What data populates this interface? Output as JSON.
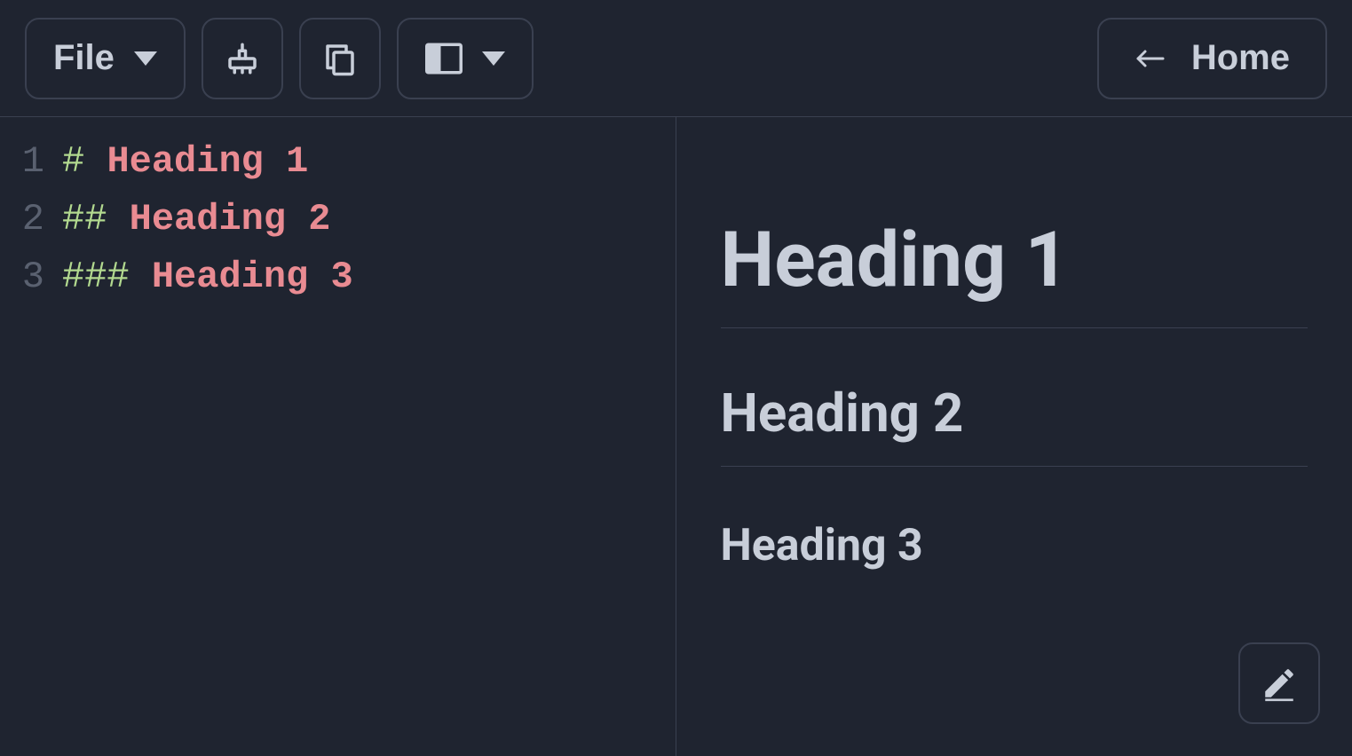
{
  "toolbar": {
    "file_label": "File",
    "home_label": "Home"
  },
  "editor": {
    "lines": [
      {
        "num": "1",
        "hashes": "#",
        "space": " ",
        "text": "Heading 1"
      },
      {
        "num": "2",
        "hashes": "##",
        "space": " ",
        "text": "Heading 2"
      },
      {
        "num": "3",
        "hashes": "###",
        "space": " ",
        "text": "Heading 3"
      }
    ]
  },
  "preview": {
    "h1": "Heading 1",
    "h2": "Heading 2",
    "h3": "Heading 3"
  }
}
